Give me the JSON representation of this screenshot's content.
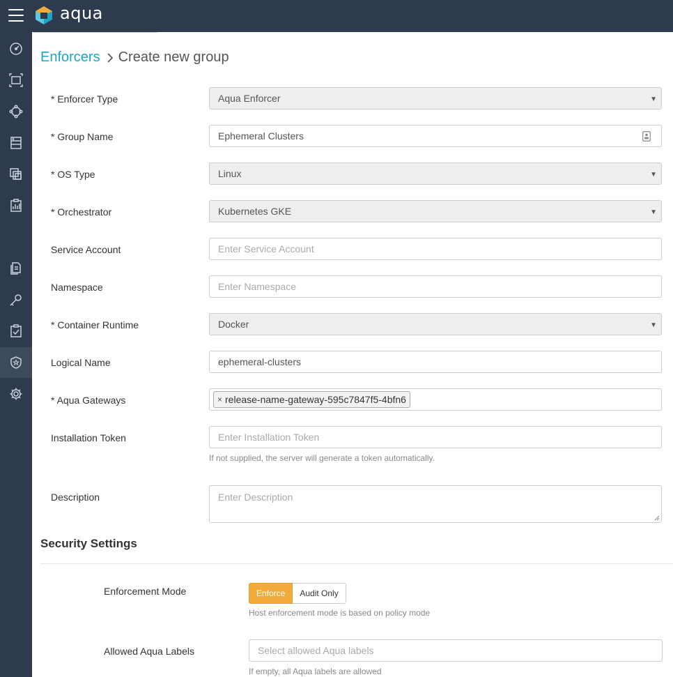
{
  "app": {
    "name": "aqua"
  },
  "breadcrumb": {
    "parent": "Enforcers",
    "current": "Create new group"
  },
  "form": {
    "enforcer_type": {
      "label": "* Enforcer Type",
      "value": "Aqua Enforcer"
    },
    "group_name": {
      "label": "* Group Name",
      "value": "Ephemeral Clusters"
    },
    "os_type": {
      "label": "* OS Type",
      "value": "Linux"
    },
    "orchestrator": {
      "label": "* Orchestrator",
      "value": "Kubernetes GKE"
    },
    "service_account": {
      "label": "Service Account",
      "value": "",
      "placeholder": "Enter Service Account"
    },
    "namespace": {
      "label": "Namespace",
      "value": "",
      "placeholder": "Enter Namespace"
    },
    "container_runtime": {
      "label": "* Container Runtime",
      "value": "Docker"
    },
    "logical_name": {
      "label": "Logical Name",
      "value": "ephemeral-clusters"
    },
    "aqua_gateways": {
      "label": "* Aqua Gateways",
      "tags": [
        "release-name-gateway-595c7847f5-4bfn6"
      ],
      "remove_glyph": "×"
    },
    "installation_token": {
      "label": "Installation Token",
      "value": "",
      "placeholder": "Enter Installation Token",
      "help": "If not supplied, the server will generate a token automatically."
    },
    "description": {
      "label": "Description",
      "value": "",
      "placeholder": "Enter Description"
    }
  },
  "security": {
    "title": "Security Settings",
    "enforcement_mode": {
      "label": "Enforcement Mode",
      "options": [
        "Enforce",
        "Audit Only"
      ],
      "selected": "Enforce",
      "help": "Host enforcement mode is based on policy mode"
    },
    "allowed_labels": {
      "label": "Allowed Aqua Labels",
      "placeholder": "Select allowed Aqua labels",
      "help": "If empty, all Aqua labels are allowed"
    }
  },
  "sidebar": {
    "items": [
      {
        "icon": "dashboard-icon"
      },
      {
        "icon": "scan-icon"
      },
      {
        "icon": "network-icon"
      },
      {
        "icon": "server-icon"
      },
      {
        "icon": "layers-icon"
      },
      {
        "icon": "report-icon"
      },
      {
        "icon": "documents-icon"
      },
      {
        "icon": "key-icon"
      },
      {
        "icon": "checklist-icon"
      },
      {
        "icon": "shield-icon",
        "active": true
      },
      {
        "icon": "gear-icon"
      }
    ]
  },
  "colors": {
    "topbar": "#2e3b4e",
    "accent": "#1da6c4",
    "enforce": "#f0ab3b"
  }
}
